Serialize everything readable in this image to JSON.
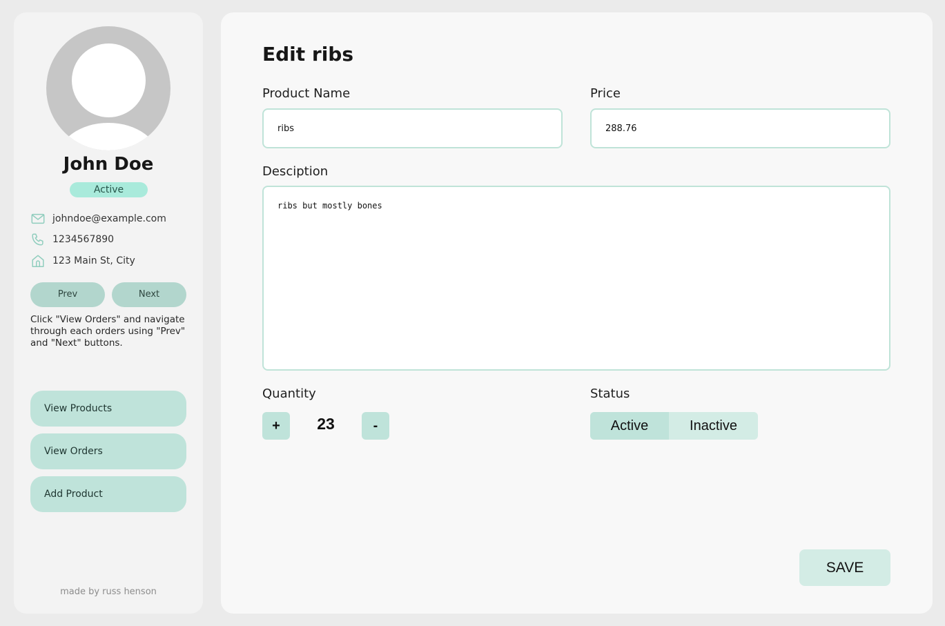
{
  "colors": {
    "accent": "#bfe3da",
    "status_badge": "#a9eadb",
    "pager_button": "#b2d6cd",
    "page_background": "#ebebeb"
  },
  "sidebar": {
    "user": {
      "name": "John Doe",
      "status": "Active",
      "email": "johndoe@example.com",
      "phone": "1234567890",
      "address": "123 Main St, City"
    },
    "contact_icons": [
      "mail-icon",
      "phone-icon",
      "home-icon"
    ],
    "pager": {
      "prev_label": "Prev",
      "next_label": "Next"
    },
    "help_text": "Click \"View Orders\" and navigate through each orders using \"Prev\" and \"Next\" buttons.",
    "nav": [
      {
        "label": "View Products"
      },
      {
        "label": "View Orders"
      },
      {
        "label": "Add Product"
      }
    ],
    "credit": "made by russ henson"
  },
  "form": {
    "title": "Edit ribs",
    "product_name": {
      "label": "Product Name",
      "value": "ribs"
    },
    "price": {
      "label": "Price",
      "value": "288.76"
    },
    "description": {
      "label": "Desciption",
      "value": "ribs but mostly bones"
    },
    "quantity": {
      "label": "Quantity",
      "value": "23",
      "increment_label": "+",
      "decrement_label": "-"
    },
    "status": {
      "label": "Status",
      "options": [
        "Active",
        "Inactive"
      ],
      "selected": "Active"
    },
    "save_label": "SAVE"
  }
}
